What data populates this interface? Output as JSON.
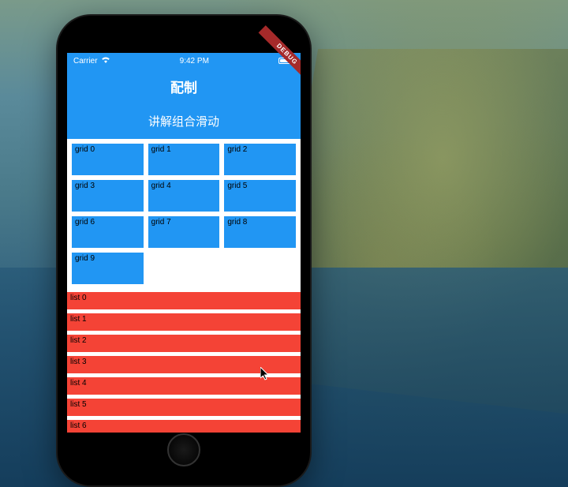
{
  "status_bar": {
    "carrier": "Carrier",
    "time": "9:42 PM"
  },
  "debug_banner": "DEBUG",
  "app_bar": {
    "title": "配制"
  },
  "section_header": "讲解组合滑动",
  "grid": {
    "items": [
      {
        "label": "grid 0"
      },
      {
        "label": "grid 1"
      },
      {
        "label": "grid 2"
      },
      {
        "label": "grid 3"
      },
      {
        "label": "grid 4"
      },
      {
        "label": "grid 5"
      },
      {
        "label": "grid 6"
      },
      {
        "label": "grid 7"
      },
      {
        "label": "grid 8"
      },
      {
        "label": "grid 9"
      }
    ]
  },
  "list": {
    "items": [
      {
        "label": "list 0"
      },
      {
        "label": "list 1"
      },
      {
        "label": "list 2"
      },
      {
        "label": "list 3"
      },
      {
        "label": "list 4"
      },
      {
        "label": "list 5"
      },
      {
        "label": "list 6"
      }
    ]
  },
  "colors": {
    "primary": "#2196F3",
    "accent": "#F44336"
  }
}
